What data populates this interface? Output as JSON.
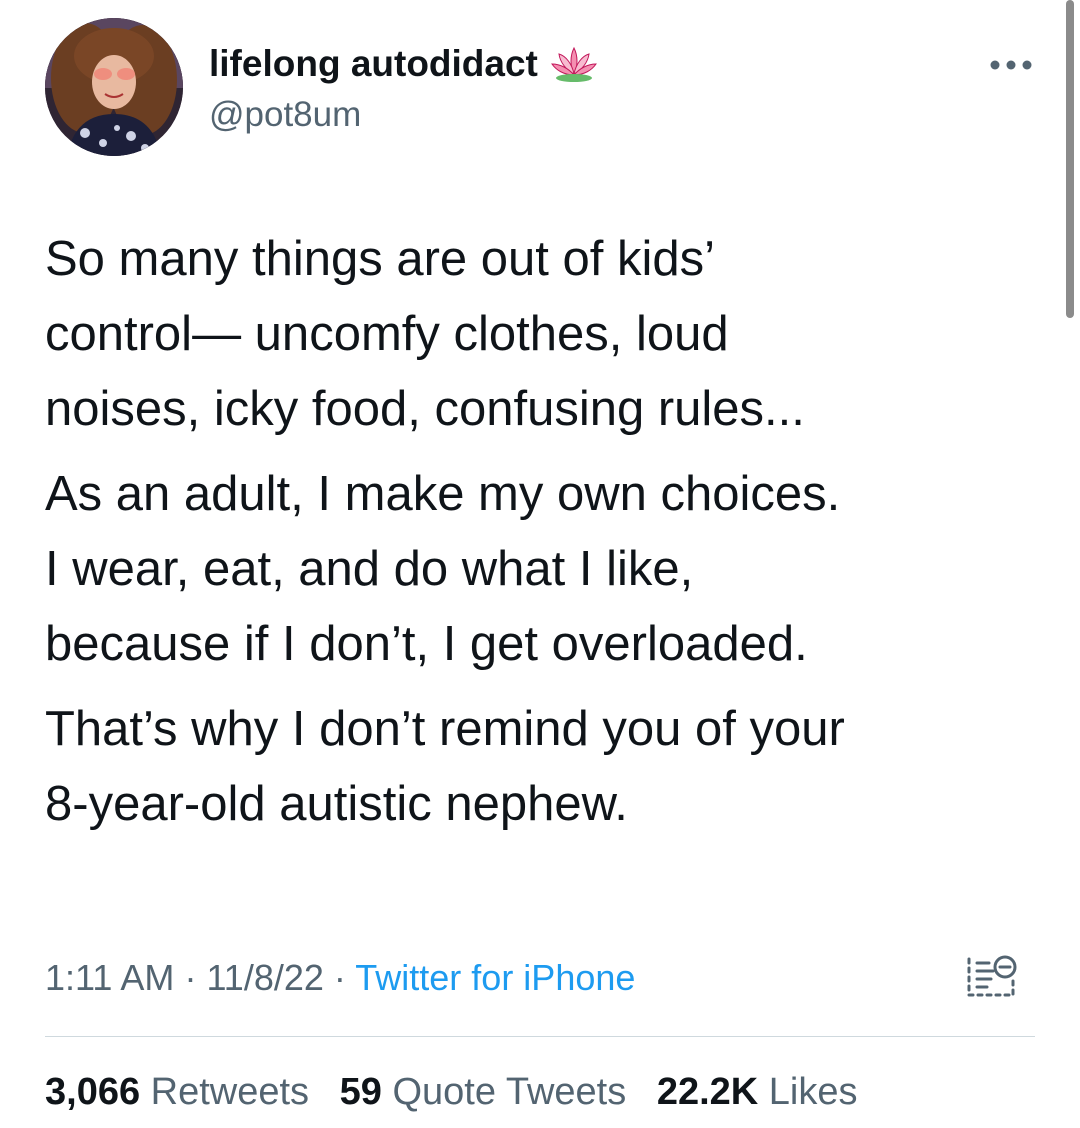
{
  "author": {
    "display_name": "lifelong autodidact",
    "badge_icon": "lotus-icon",
    "handle": "@pot8um",
    "avatar": "profile-photo"
  },
  "tweet": {
    "paragraphs": [
      [
        "So many things are out of kids’",
        "control— uncomfy clothes, loud",
        "noises, icky food, confusing rules..."
      ],
      [
        "As an adult, I make my own choices.",
        "I wear, eat, and do what I like,",
        "because if I don’t, I get overloaded."
      ],
      [
        "That’s why I don’t remind you of your",
        "8-year-old autistic nephew."
      ]
    ]
  },
  "meta": {
    "time": "1:11 AM",
    "separator": "·",
    "date": "11/8/22",
    "source": "Twitter for iPhone"
  },
  "stats": {
    "retweets_count": "3,066",
    "retweets_label": "Retweets",
    "quotes_count": "59",
    "quotes_label": "Quote Tweets",
    "likes_count": "22.2K",
    "likes_label": "Likes"
  },
  "colors": {
    "text": "#0f1419",
    "secondary": "#536471",
    "link": "#1d9bf0",
    "divider": "#cfd9de"
  }
}
